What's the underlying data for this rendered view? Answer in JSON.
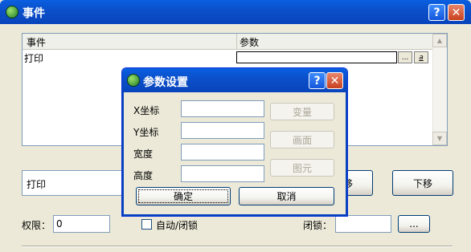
{
  "window": {
    "title": "事件"
  },
  "table": {
    "headers": [
      "事件",
      "参数"
    ],
    "rows": [
      {
        "event": "打印",
        "param": ""
      }
    ],
    "cell_buttons": [
      "...",
      "a"
    ]
  },
  "event_field": {
    "value": "打印"
  },
  "buttons": {
    "move_up_partial": "移",
    "move_down": "下移",
    "browse": "..."
  },
  "permission": {
    "label": "权限：",
    "value": "0"
  },
  "auto_lock": {
    "label": "自动/闭锁",
    "checked": false
  },
  "lock": {
    "label": "闭锁：",
    "value": ""
  },
  "dialog": {
    "title": "参数设置",
    "fields": [
      {
        "label": "X坐标",
        "value": "",
        "button": "变量"
      },
      {
        "label": "Y坐标",
        "value": "",
        "button": "画面"
      },
      {
        "label": "宽度",
        "value": "",
        "button": "图元"
      },
      {
        "label": "高度",
        "value": ""
      }
    ],
    "ok": "确定",
    "cancel": "取消"
  }
}
